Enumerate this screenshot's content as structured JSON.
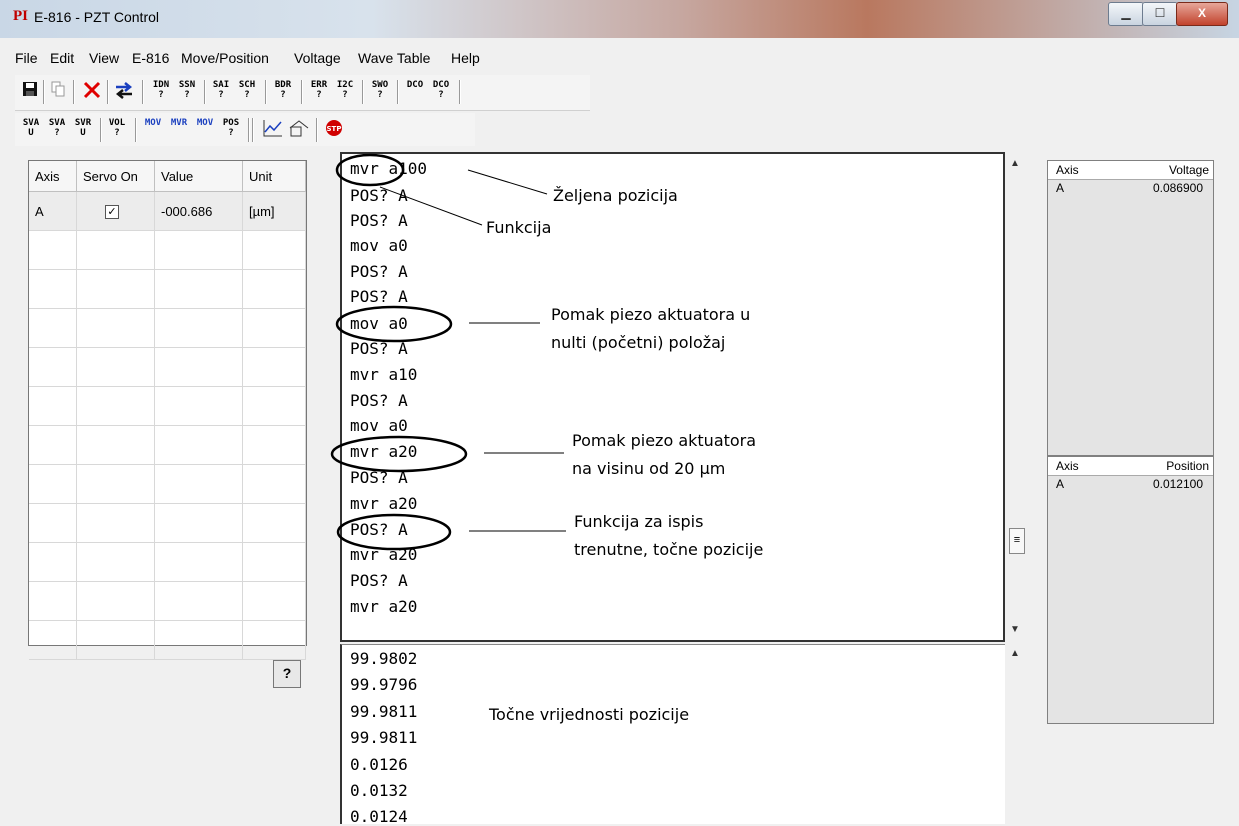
{
  "window": {
    "logo": "PI",
    "title": "E-816 - PZT Control",
    "min_glyph": "▁",
    "max_glyph": "☐",
    "close_glyph": "X"
  },
  "menu": [
    "File",
    "Edit",
    "View",
    "E-816",
    "Move/Position",
    "Voltage",
    "Wave Table",
    "Help"
  ],
  "toolbar1": {
    "icons": [
      "save-icon",
      "copy-icon",
      "delete-icon",
      "connect-icon"
    ],
    "buttons": [
      "IDN ?",
      "SSN ?",
      "SAI ?",
      "SCH ?",
      "BDR ?",
      "ERR ?",
      "I2C ?",
      "SWO ?",
      "DCO",
      "DCO ?"
    ]
  },
  "toolbar2": {
    "buttons": [
      "SVA U",
      "SVA ?",
      "SVR U",
      "VOL ?",
      "MOV",
      "MVR",
      "MOV",
      "POS ?"
    ],
    "icons": [
      "chart-icon",
      "wave-icon",
      "stop-icon"
    ],
    "stop_label": "STP"
  },
  "axis_grid": {
    "headers": [
      "Axis",
      "Servo On",
      "Value",
      "Unit"
    ],
    "rows": [
      {
        "axis": "A",
        "servo_on": true,
        "value": "-000.686",
        "unit": "[µm]"
      }
    ],
    "checkmark": "✓"
  },
  "help_button": "?",
  "command_log": [
    "mvr a100",
    "POS? A",
    "POS? A",
    "mov a0",
    "POS? A",
    "POS? A",
    "mov a0",
    "POS? A",
    "mvr a10",
    "POS? A",
    "mov a0",
    "mvr a20",
    "POS? A",
    "mvr a20",
    "POS? A",
    "mvr a20",
    "POS? A",
    "mvr a20"
  ],
  "output_log": [
    "99.9802",
    "99.9796",
    "99.9811",
    "99.9811",
    "0.0126",
    "0.0132",
    "0.0124"
  ],
  "annotations": {
    "zeljena": "Željena pozicija",
    "funkcija": "Funkcija",
    "pomak1_l1": "Pomak piezo aktuatora u",
    "pomak1_l2": "nulti (početni) položaj",
    "pomak2_l1": "Pomak piezo aktuatora",
    "pomak2_l2": "na visinu od 20 μm",
    "ispis_l1": "Funkcija za ispis",
    "ispis_l2": "trenutne, točne pozicije",
    "tocne": "Točne vrijednosti pozicije"
  },
  "voltage_panel": {
    "headers": [
      "Axis",
      "Voltage"
    ],
    "rows": [
      {
        "axis": "A",
        "value": "0.086900"
      }
    ]
  },
  "position_panel": {
    "headers": [
      "Axis",
      "Position"
    ],
    "rows": [
      {
        "axis": "A",
        "value": "0.012100"
      }
    ]
  },
  "scroll": {
    "up": "▲",
    "down": "▼",
    "thumb": "≡"
  }
}
